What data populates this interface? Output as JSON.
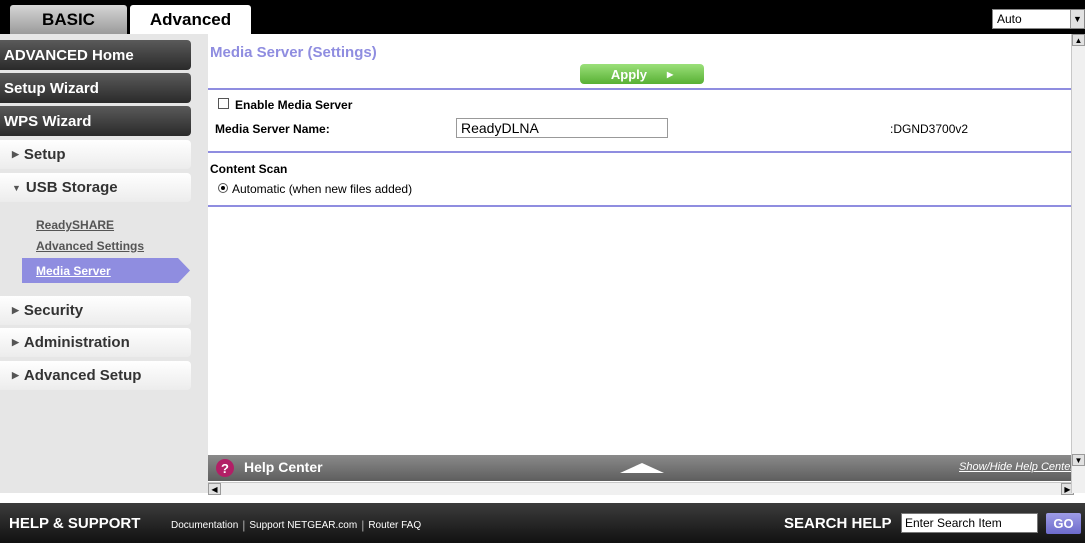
{
  "tabs": {
    "basic": "BASIC",
    "advanced": "Advanced"
  },
  "language_select": {
    "value": "Auto"
  },
  "sidebar": {
    "advanced_home": "ADVANCED Home",
    "setup_wizard": "Setup Wizard",
    "wps_wizard": "WPS Wizard",
    "setup": "Setup",
    "usb_storage": "USB Storage",
    "usb_sub": {
      "readyshare": "ReadySHARE",
      "advanced_settings": "Advanced Settings",
      "media_server": "Media Server"
    },
    "security": "Security",
    "administration": "Administration",
    "advanced_setup": "Advanced Setup"
  },
  "main": {
    "title": "Media Server (Settings)",
    "apply_label": "Apply",
    "enable_media_server_label": "Enable Media Server",
    "enable_media_server_checked": false,
    "media_server_name_label": "Media Server Name:",
    "media_server_name_value": "ReadyDLNA",
    "device_suffix": ":DGND3700v2",
    "content_scan_label": "Content Scan",
    "automatic_label": "Automatic (when new files added)"
  },
  "help_center": {
    "title": "Help Center",
    "toggle_label": "Show/Hide Help Center"
  },
  "footer": {
    "title": "HELP & SUPPORT",
    "links": [
      "Documentation",
      "Support NETGEAR.com",
      "Router FAQ"
    ],
    "search_label": "SEARCH HELP",
    "search_placeholder": "Enter Search Item",
    "go_label": "GO"
  },
  "colors": {
    "accent": "#8f8de0",
    "apply_green": "#58b034",
    "help_icon": "#b21f66"
  },
  "icons": {
    "collapsed": "triangle-right-icon",
    "expanded": "triangle-down-icon",
    "help": "question-icon"
  }
}
